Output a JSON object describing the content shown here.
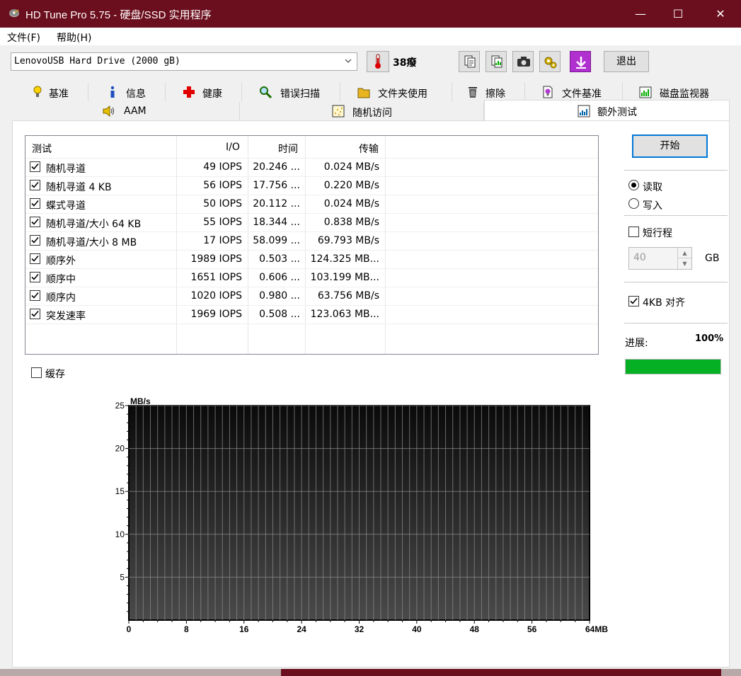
{
  "window": {
    "title": "HD Tune Pro 5.75 - 硬盘/SSD 实用程序",
    "minimize": "—",
    "maximize": "☐",
    "close": "✕"
  },
  "menu": {
    "file": "文件(F)",
    "help": "帮助(H)"
  },
  "toolbar": {
    "drive": "LenovoUSB Hard Drive (2000 gB)",
    "temperature": "38癈",
    "exit": "退出"
  },
  "tabs": {
    "row1": [
      {
        "label": "基准",
        "icon": "lightbulb-icon"
      },
      {
        "label": "信息",
        "icon": "info-icon"
      },
      {
        "label": "健康",
        "icon": "health-cross-icon"
      },
      {
        "label": "错误扫描",
        "icon": "magnifier-icon"
      },
      {
        "label": "文件夹使用",
        "icon": "folder-icon"
      },
      {
        "label": "擦除",
        "icon": "trash-icon"
      },
      {
        "label": "文件基准",
        "icon": "file-bulb-icon"
      },
      {
        "label": "磁盘监视器",
        "icon": "monitor-chart-icon"
      }
    ],
    "row2": [
      {
        "label": "AAM",
        "icon": "speaker-icon"
      },
      {
        "label": "随机访问",
        "icon": "random-dots-icon"
      },
      {
        "label": "额外测试",
        "icon": "extra-chart-icon"
      }
    ]
  },
  "table": {
    "headers": {
      "test": "测试",
      "io": "I/O",
      "time": "时间",
      "transfer": "传输"
    },
    "rows": [
      {
        "test": "随机寻道",
        "io": "49 IOPS",
        "time": "20.246 ...",
        "transfer": "0.024 MB/s",
        "checked": true
      },
      {
        "test": "随机寻道 4 KB",
        "io": "56 IOPS",
        "time": "17.756 ...",
        "transfer": "0.220 MB/s",
        "checked": true
      },
      {
        "test": "蝶式寻道",
        "io": "50 IOPS",
        "time": "20.112 ...",
        "transfer": "0.024 MB/s",
        "checked": true
      },
      {
        "test": "随机寻道/大小 64 KB",
        "io": "55 IOPS",
        "time": "18.344 ...",
        "transfer": "0.838 MB/s",
        "checked": true
      },
      {
        "test": "随机寻道/大小 8 MB",
        "io": "17 IOPS",
        "time": "58.099 ...",
        "transfer": "69.793 MB/s",
        "checked": true
      },
      {
        "test": "顺序外",
        "io": "1989 IOPS",
        "time": "0.503 ...",
        "transfer": "124.325 MB...",
        "checked": true
      },
      {
        "test": "顺序中",
        "io": "1651 IOPS",
        "time": "0.606 ...",
        "transfer": "103.199 MB...",
        "checked": true
      },
      {
        "test": "顺序内",
        "io": "1020 IOPS",
        "time": "0.980 ...",
        "transfer": "63.756 MB/s",
        "checked": true
      },
      {
        "test": "突发速率",
        "io": "1969 IOPS",
        "time": "0.508 ...",
        "transfer": "123.063 MB...",
        "checked": true
      }
    ]
  },
  "cache": {
    "label": "缓存",
    "checked": false
  },
  "right": {
    "start": "开始",
    "read": "读取",
    "write": "写入",
    "mode": "read",
    "short_stroke": "短行程",
    "short_stroke_checked": false,
    "size": "40",
    "size_unit": "GB",
    "align": "4KB 对齐",
    "align_checked": true,
    "progress_label": "进展:",
    "progress_text": "100%",
    "progress": 1.0
  },
  "chart_data": {
    "type": "line",
    "ylabel": "MB/s",
    "xlabel": "",
    "yticks": [
      "25",
      "20",
      "15",
      "10",
      "5"
    ],
    "xticks": [
      "0",
      "8",
      "16",
      "24",
      "32",
      "40",
      "48",
      "56",
      "64MB"
    ],
    "ylim": [
      0,
      25
    ],
    "xlim": [
      0,
      64
    ],
    "series": []
  },
  "colors": {
    "titlebar": "#6b0e1d",
    "progress": "#06b025",
    "accent": "#0078d7"
  }
}
